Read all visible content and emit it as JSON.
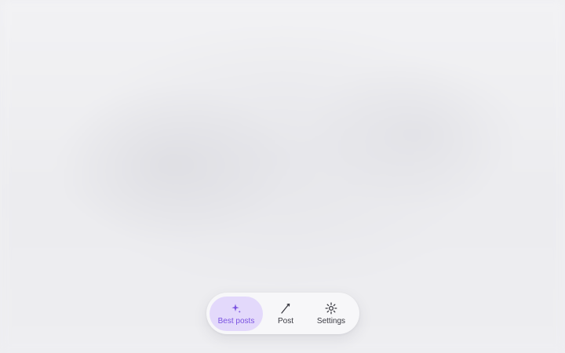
{
  "tabbar": {
    "tabs": [
      {
        "id": "best-posts",
        "label": "Best posts",
        "icon": "sparkle-icon",
        "active": true
      },
      {
        "id": "post",
        "label": "Post",
        "icon": "pen-icon",
        "active": false
      },
      {
        "id": "settings",
        "label": "Settings",
        "icon": "gear-icon",
        "active": false
      }
    ]
  },
  "colors": {
    "accent": "#7a52e0",
    "active_tab_bg": "#e3d9fb",
    "text": "#3a3a42",
    "bar_bg": "#f7f7f9",
    "page_bg": "#efeff2"
  }
}
